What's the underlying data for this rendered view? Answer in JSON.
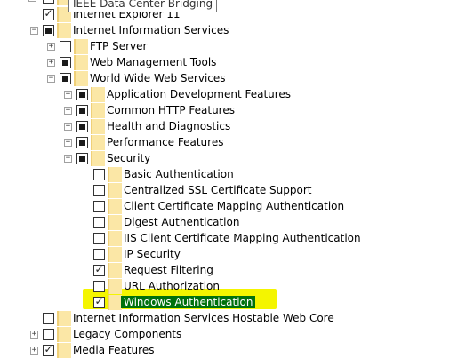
{
  "tooltip": "IEEE Data Center Bridging",
  "items": [
    {
      "label": "Internet Explorer 11",
      "state": "checked"
    },
    {
      "label": "Internet Information Services",
      "state": "partial",
      "expander": "−"
    },
    {
      "label": "FTP Server",
      "state": "unchecked",
      "expander": "+"
    },
    {
      "label": "Web Management Tools",
      "state": "partial",
      "expander": "+"
    },
    {
      "label": "World Wide Web Services",
      "state": "partial",
      "expander": "−"
    },
    {
      "label": "Application Development Features",
      "state": "partial",
      "expander": "+"
    },
    {
      "label": "Common HTTP Features",
      "state": "partial",
      "expander": "+"
    },
    {
      "label": "Health and Diagnostics",
      "state": "partial",
      "expander": "+"
    },
    {
      "label": "Performance Features",
      "state": "partial",
      "expander": "+"
    },
    {
      "label": "Security",
      "state": "partial",
      "expander": "−"
    },
    {
      "label": "Basic Authentication",
      "state": "unchecked"
    },
    {
      "label": "Centralized SSL Certificate Support",
      "state": "unchecked"
    },
    {
      "label": "Client Certificate Mapping Authentication",
      "state": "unchecked"
    },
    {
      "label": "Digest Authentication",
      "state": "unchecked"
    },
    {
      "label": "IIS Client Certificate Mapping Authentication",
      "state": "unchecked"
    },
    {
      "label": "IP Security",
      "state": "unchecked"
    },
    {
      "label": "Request Filtering",
      "state": "checked"
    },
    {
      "label": "URL Authorization",
      "state": "unchecked"
    },
    {
      "label": "Windows Authentication",
      "state": "checked",
      "selected": true
    },
    {
      "label": "Internet Information Services Hostable Web Core",
      "state": "unchecked"
    },
    {
      "label": "Legacy Components",
      "state": "unchecked",
      "expander": "+"
    },
    {
      "label": "Media Features",
      "state": "checked",
      "expander": "+"
    }
  ]
}
